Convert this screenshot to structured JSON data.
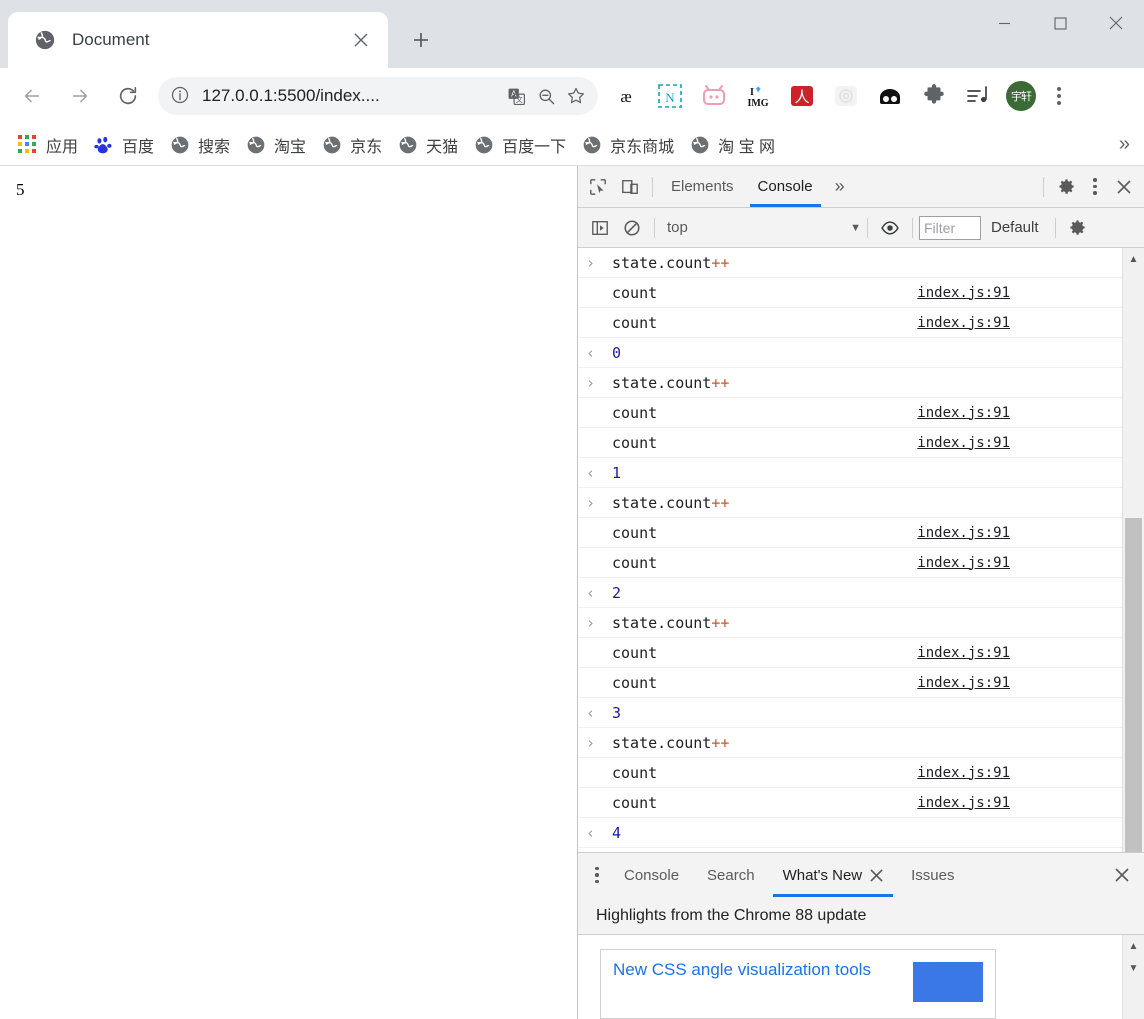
{
  "window": {
    "controls": [
      "minimize",
      "maximize",
      "close"
    ]
  },
  "tab": {
    "title": "Document",
    "favicon": "globe-icon",
    "close_label": "×",
    "newtab_label": "+"
  },
  "toolbar": {
    "back": "back-icon",
    "forward": "forward-icon",
    "reload": "reload-icon",
    "url": "127.0.0.1:5500/index....",
    "info_icon": "info-icon",
    "translate_icon": "translate-icon",
    "zoomout_icon": "zoom-out-icon",
    "bookmark_icon": "star-icon",
    "extensions": [
      {
        "name": "ae-extension",
        "label": "æ"
      },
      {
        "name": "notion-clipper-extension",
        "label": "N"
      },
      {
        "name": "bilibili-extension",
        "label": "TV"
      },
      {
        "name": "iloveimg-extension",
        "label": "I♥ IMG"
      },
      {
        "name": "adobe-acrobat-extension",
        "label": "A"
      },
      {
        "name": "dapp-extension",
        "label": "⚙"
      },
      {
        "name": "dark-reader-extension",
        "label": "●●"
      },
      {
        "name": "extensions-puzzle",
        "label": "✦"
      },
      {
        "name": "music-list-extension",
        "label": "♪"
      }
    ],
    "avatar": "宇轩",
    "menu": "chrome-menu-icon"
  },
  "bookmarks": {
    "apps_label": "应用",
    "items": [
      {
        "label": "百度",
        "icon": "baidu-icon"
      },
      {
        "label": "搜索",
        "icon": "globe-icon"
      },
      {
        "label": "淘宝",
        "icon": "globe-icon"
      },
      {
        "label": "京东",
        "icon": "globe-icon"
      },
      {
        "label": "天猫",
        "icon": "globe-icon"
      },
      {
        "label": "百度一下",
        "icon": "globe-icon"
      },
      {
        "label": "京东商城",
        "icon": "globe-icon"
      },
      {
        "label": "淘 宝 网",
        "icon": "globe-icon"
      }
    ],
    "overflow": "»"
  },
  "page": {
    "content": "5"
  },
  "devtools": {
    "inspect_icon": "inspect-element-icon",
    "device_icon": "device-toolbar-icon",
    "tabs": [
      {
        "label": "Elements",
        "active": false
      },
      {
        "label": "Console",
        "active": true
      }
    ],
    "more_tabs": "»",
    "settings_icon": "gear-icon",
    "more_icon": "vertical-dots-icon",
    "close_icon": "close-icon",
    "filterbar": {
      "sidebar_icon": "console-sidebar-icon",
      "clear_icon": "clear-console-icon",
      "context": "top",
      "caret": "▼",
      "eye_icon": "live-expression-icon",
      "filter_placeholder": "Filter",
      "level": "Default",
      "settings_icon": "gear-icon"
    },
    "console_rows": [
      {
        "type": "input",
        "gutter": "›",
        "text": "state.count",
        "op": "++",
        "source": ""
      },
      {
        "type": "log",
        "gutter": "",
        "text": "count",
        "op": "",
        "source": "index.js:91"
      },
      {
        "type": "log",
        "gutter": "",
        "text": "count",
        "op": "",
        "source": "index.js:91"
      },
      {
        "type": "result",
        "gutter": "‹",
        "text": "0",
        "op": "",
        "source": ""
      },
      {
        "type": "input",
        "gutter": "›",
        "text": "state.count",
        "op": "++",
        "source": ""
      },
      {
        "type": "log",
        "gutter": "",
        "text": "count",
        "op": "",
        "source": "index.js:91"
      },
      {
        "type": "log",
        "gutter": "",
        "text": "count",
        "op": "",
        "source": "index.js:91"
      },
      {
        "type": "result",
        "gutter": "‹",
        "text": "1",
        "op": "",
        "source": ""
      },
      {
        "type": "input",
        "gutter": "›",
        "text": "state.count",
        "op": "++",
        "source": ""
      },
      {
        "type": "log",
        "gutter": "",
        "text": "count",
        "op": "",
        "source": "index.js:91"
      },
      {
        "type": "log",
        "gutter": "",
        "text": "count",
        "op": "",
        "source": "index.js:91"
      },
      {
        "type": "result",
        "gutter": "‹",
        "text": "2",
        "op": "",
        "source": ""
      },
      {
        "type": "input",
        "gutter": "›",
        "text": "state.count",
        "op": "++",
        "source": ""
      },
      {
        "type": "log",
        "gutter": "",
        "text": "count",
        "op": "",
        "source": "index.js:91"
      },
      {
        "type": "log",
        "gutter": "",
        "text": "count",
        "op": "",
        "source": "index.js:91"
      },
      {
        "type": "result",
        "gutter": "‹",
        "text": "3",
        "op": "",
        "source": ""
      },
      {
        "type": "input",
        "gutter": "›",
        "text": "state.count",
        "op": "++",
        "source": ""
      },
      {
        "type": "log",
        "gutter": "",
        "text": "count",
        "op": "",
        "source": "index.js:91"
      },
      {
        "type": "log",
        "gutter": "",
        "text": "count",
        "op": "",
        "source": "index.js:91"
      },
      {
        "type": "result",
        "gutter": "‹",
        "text": "4",
        "op": "",
        "source": ""
      },
      {
        "type": "prompt",
        "gutter": "›",
        "text": "",
        "op": "",
        "source": ""
      }
    ],
    "drawer": {
      "menu_icon": "vertical-dots-icon",
      "tabs": [
        {
          "label": "Console",
          "active": false,
          "closable": false
        },
        {
          "label": "Search",
          "active": false,
          "closable": false
        },
        {
          "label": "What's New",
          "active": true,
          "closable": true
        },
        {
          "label": "Issues",
          "active": false,
          "closable": false
        }
      ],
      "close_icon": "close-icon",
      "subtitle": "Highlights from the Chrome 88 update",
      "card_title": "New CSS angle visualization tools"
    }
  },
  "colors": {
    "accent": "#1a73e8",
    "chrome_tabstrip": "#dee1e6",
    "devtools_bg": "#f3f3f3",
    "result_blue": "#1a1aa6",
    "operator_orange": "#c5582b",
    "avatar_green": "#3a6b35"
  }
}
